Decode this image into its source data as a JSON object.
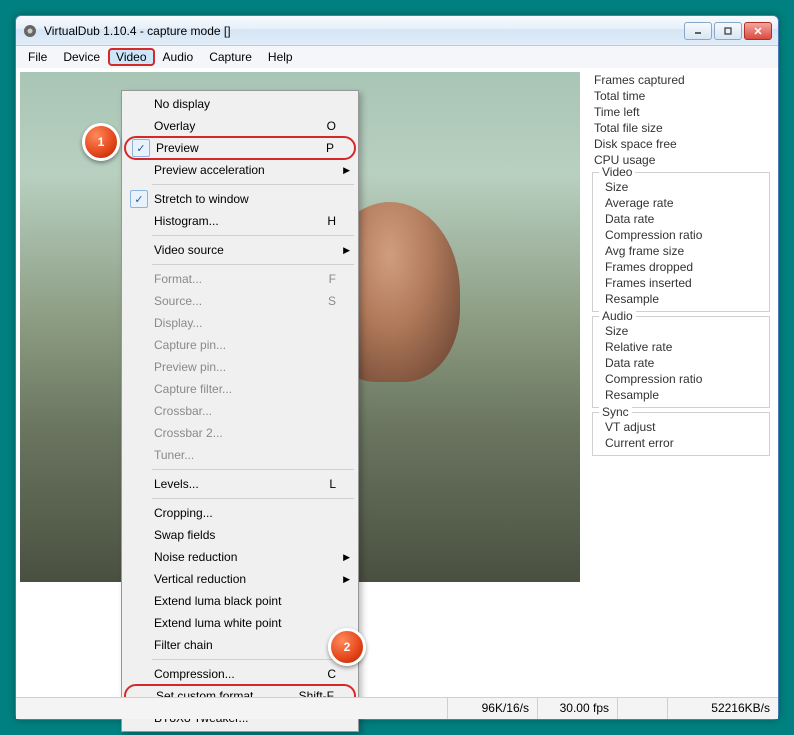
{
  "window": {
    "title": "VirtualDub 1.10.4 - capture mode []"
  },
  "menubar": {
    "file": "File",
    "device": "Device",
    "video": "Video",
    "audio": "Audio",
    "capture": "Capture",
    "help": "Help"
  },
  "dropdown": {
    "no_display": "No display",
    "overlay": "Overlay",
    "overlay_key": "O",
    "preview": "Preview",
    "preview_key": "P",
    "preview_accel": "Preview acceleration",
    "stretch": "Stretch to window",
    "histogram": "Histogram...",
    "histogram_key": "H",
    "video_source": "Video source",
    "format": "Format...",
    "format_key": "F",
    "source": "Source...",
    "source_key": "S",
    "display": "Display...",
    "capture_pin": "Capture pin...",
    "preview_pin": "Preview pin...",
    "capture_filter": "Capture filter...",
    "crossbar": "Crossbar...",
    "crossbar2": "Crossbar 2...",
    "tuner": "Tuner...",
    "levels": "Levels...",
    "levels_key": "L",
    "cropping": "Cropping...",
    "swap_fields": "Swap fields",
    "noise_reduction": "Noise reduction",
    "vertical_reduction": "Vertical reduction",
    "extend_black": "Extend luma black point",
    "extend_white": "Extend luma white point",
    "filter_chain": "Filter chain",
    "compression": "Compression...",
    "compression_key": "C",
    "set_custom": "Set custom format...",
    "set_custom_key": "Shift-F",
    "bt8x8": "BT8X8 Tweaker..."
  },
  "stats": {
    "frames_captured": "Frames captured",
    "total_time": "Total time",
    "time_left": "Time left",
    "total_file_size": "Total file size",
    "disk_space_free": "Disk space free",
    "cpu_usage": "CPU usage",
    "video_legend": "Video",
    "size": "Size",
    "average_rate": "Average rate",
    "data_rate": "Data rate",
    "compression_ratio": "Compression ratio",
    "avg_frame_size": "Avg frame size",
    "frames_dropped": "Frames dropped",
    "frames_inserted": "Frames inserted",
    "resample": "Resample",
    "audio_legend": "Audio",
    "relative_rate": "Relative rate",
    "sync_legend": "Sync",
    "vt_adjust": "VT adjust",
    "current_error": "Current error"
  },
  "statusbar": {
    "rate": "96K/16/s",
    "fps": "30.00 fps",
    "bandwidth": "52216KB/s"
  },
  "badges": {
    "one": "1",
    "two": "2"
  }
}
